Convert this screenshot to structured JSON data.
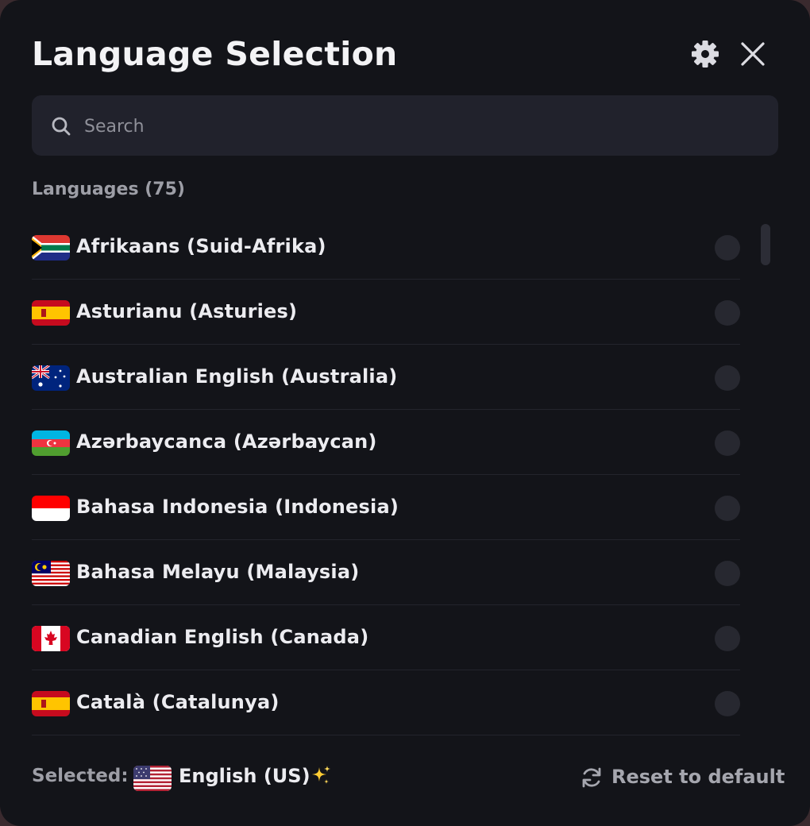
{
  "dialog": {
    "title": "Language Selection",
    "search": {
      "placeholder": "Search",
      "value": ""
    },
    "section_label": "Languages (75)",
    "languages": [
      {
        "label": "Afrikaans (Suid-Afrika)",
        "flag": "south-africa-flag",
        "selected": false
      },
      {
        "label": "Asturianu (Asturies)",
        "flag": "spain-flag",
        "selected": false
      },
      {
        "label": "Australian English (Australia)",
        "flag": "australia-flag",
        "selected": false
      },
      {
        "label": "Azərbaycanca (Azərbaycan)",
        "flag": "azerbaijan-flag",
        "selected": false
      },
      {
        "label": "Bahasa Indonesia (Indonesia)",
        "flag": "indonesia-flag",
        "selected": false
      },
      {
        "label": "Bahasa Melayu (Malaysia)",
        "flag": "malaysia-flag",
        "selected": false
      },
      {
        "label": "Canadian English (Canada)",
        "flag": "canada-flag",
        "selected": false
      },
      {
        "label": "Català (Catalunya)",
        "flag": "spain-flag",
        "selected": false
      }
    ],
    "footer": {
      "selected_label": "Selected:",
      "selected_language": "English (US)",
      "selected_flag": "usa-flag",
      "reset_label": "Reset to default"
    }
  },
  "icons": {
    "settings": "gear-icon",
    "close": "close-icon",
    "search": "search-icon",
    "reset": "refresh-icon",
    "sparkle": "sparkle-icon"
  },
  "colors": {
    "background": "#131419",
    "surface": "#21222c",
    "text_primary": "#ececf0",
    "text_secondary": "#9d9ea6",
    "radio": "#272830"
  }
}
